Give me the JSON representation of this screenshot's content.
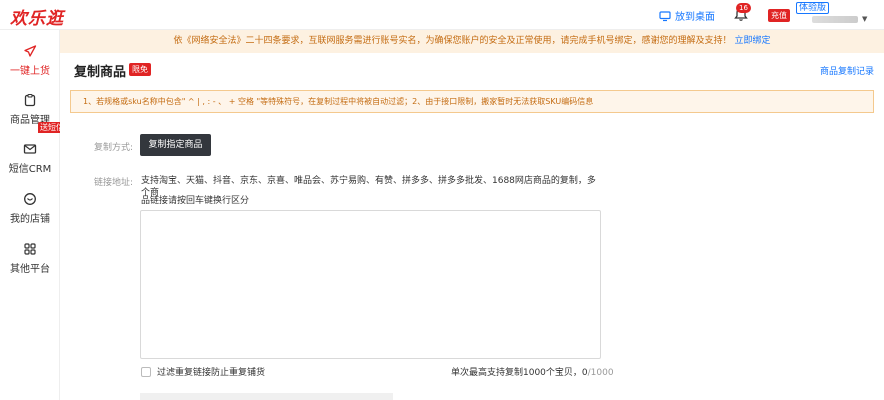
{
  "header": {
    "logo": "欢乐逛",
    "desktop_label": "放到桌面",
    "notif_count": "16",
    "recharge_label": "充值",
    "trial_label": "体验版",
    "accent": "#e02424",
    "link_color": "#1677ff"
  },
  "sidebar": {
    "items": [
      {
        "label": "一键上货",
        "icon": "paper-plane-icon"
      },
      {
        "label": "商品管理",
        "icon": "clipboard-icon"
      },
      {
        "label": "短信CRM",
        "icon": "mail-icon"
      },
      {
        "label": "我的店铺",
        "icon": "store-icon"
      },
      {
        "label": "其他平台",
        "icon": "grid-icon"
      }
    ],
    "sms_badge": "送短信"
  },
  "notice": {
    "text": "依《网络安全法》二十四条要求，互联网服务需进行账号实名，为确保您账户的安全及正常使用，请完成手机号绑定，感谢您的理解及支持！",
    "link": "立即绑定"
  },
  "page": {
    "title": "复制商品",
    "badge": "限免",
    "record_link": "商品复制记录"
  },
  "tip": "1、若规格或sku名称中包含\" ^ | , : - 、 + 空格 \"等特殊符号，在复制过程中将被自动过滤；2、由于接口限制，搬家暂时无法获取SKU编码信息",
  "form": {
    "copy_mode_label": "复制方式:",
    "copy_btn": "复制指定商品",
    "link_label": "链接地址:",
    "desc_line1": "支持淘宝、天猫、抖音、京东、京喜、唯品会、苏宁易购、有赞、拼多多、拼多多批发、1688网店商品的复制，多个商",
    "desc_line2": "品链接请按回车键换行区分",
    "textarea_value": "",
    "filter_label": "过滤重复链接防止重复铺货",
    "limit_text": "单次最高支持复制1000个宝贝，",
    "limit_count": "0",
    "limit_max": "/1000"
  }
}
